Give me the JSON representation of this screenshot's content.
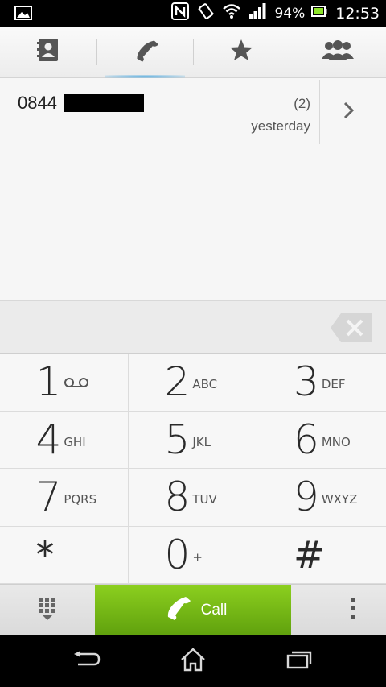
{
  "status_bar": {
    "battery_percent": "94%",
    "time": "12:53",
    "icons": [
      "gallery-icon",
      "nfc-icon",
      "vibrate-icon",
      "wifi-icon",
      "signal-icon",
      "battery-icon"
    ]
  },
  "tabs": [
    {
      "icon": "contacts-icon",
      "active": false
    },
    {
      "icon": "phone-icon",
      "active": true
    },
    {
      "icon": "star-icon",
      "active": false
    },
    {
      "icon": "groups-icon",
      "active": false
    }
  ],
  "call_log": [
    {
      "number_prefix": "0844",
      "count": "(2)",
      "time": "yesterday"
    }
  ],
  "keypad": [
    {
      "digit": "1",
      "letters": "",
      "voicemail": true
    },
    {
      "digit": "2",
      "letters": "ABC"
    },
    {
      "digit": "3",
      "letters": "DEF"
    },
    {
      "digit": "4",
      "letters": "GHI"
    },
    {
      "digit": "5",
      "letters": "JKL"
    },
    {
      "digit": "6",
      "letters": "MNO"
    },
    {
      "digit": "7",
      "letters": "PQRS"
    },
    {
      "digit": "8",
      "letters": "TUV"
    },
    {
      "digit": "9",
      "letters": "WXYZ"
    },
    {
      "digit": "*",
      "letters": ""
    },
    {
      "digit": "0",
      "letters": "+"
    },
    {
      "digit": "#",
      "letters": ""
    }
  ],
  "actions": {
    "call_label": "Call"
  },
  "colors": {
    "call_green": "#7cbf18",
    "accent_blue": "#5fb0e0"
  }
}
